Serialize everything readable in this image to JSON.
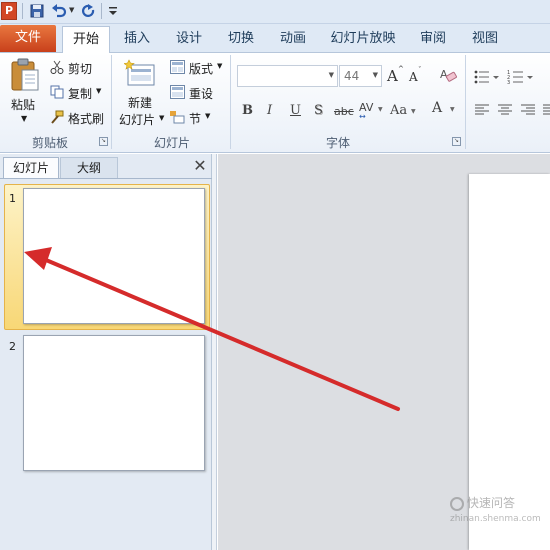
{
  "quick_access": {
    "app_icon": "P",
    "items": [
      "save-icon",
      "undo-icon",
      "redo-icon",
      "customize-icon"
    ]
  },
  "tabs": [
    "文件",
    "开始",
    "插入",
    "设计",
    "切换",
    "动画",
    "幻灯片放映",
    "审阅",
    "视图"
  ],
  "active_tab": "开始",
  "ribbon": {
    "clipboard": {
      "paste": "粘贴",
      "cut": "剪切",
      "copy": "复制",
      "format_painter": "格式刷",
      "group_label": "剪贴板"
    },
    "slides": {
      "new_slide_line1": "新建",
      "new_slide_line2": "幻灯片",
      "layout": "版式",
      "reset": "重设",
      "section": "节",
      "group_label": "幻灯片"
    },
    "font": {
      "font_name": "",
      "font_size": "44",
      "grow": "A",
      "shrink": "A",
      "bold": "B",
      "italic": "I",
      "underline": "U",
      "shadow": "S",
      "strike": "abc",
      "spacing": "AV",
      "case": "Aa",
      "color": "A",
      "group_label": "字体"
    }
  },
  "pane": {
    "tab_slides": "幻灯片",
    "tab_outline": "大纲",
    "close": "✕",
    "slides": [
      {
        "number": "1",
        "selected": true
      },
      {
        "number": "2",
        "selected": false
      }
    ]
  },
  "watermark": {
    "brand": "快速问答",
    "domain": "zhinan.shenma.com"
  },
  "colors": {
    "file_tab": "#d24726",
    "accent_arrow": "#d52b2b",
    "selection": "#f8d776"
  }
}
